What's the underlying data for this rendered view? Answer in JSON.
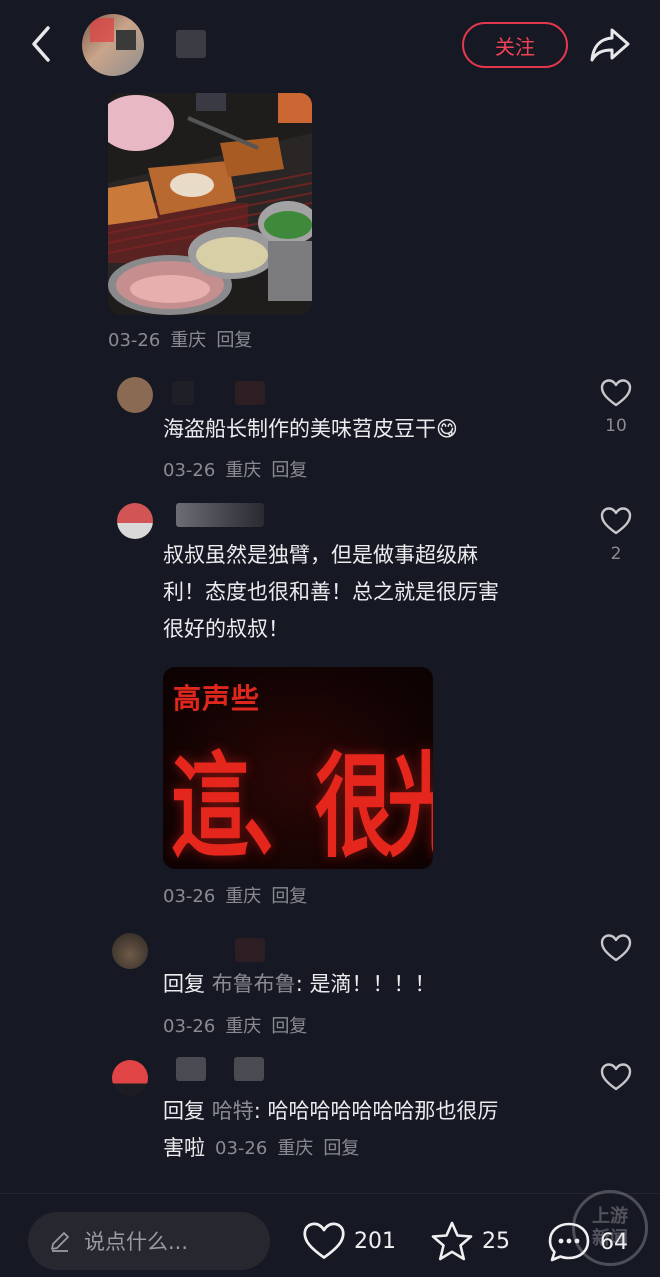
{
  "header": {
    "follow_label": "关注"
  },
  "post": {
    "meta": {
      "date": "03-26",
      "location": "重庆",
      "reply": "回复"
    }
  },
  "comments": [
    {
      "text": "海盗船长制作的美味苕皮豆干",
      "emoji": "😋",
      "meta": {
        "date": "03-26",
        "location": "重庆",
        "reply": "回复"
      },
      "likes": "10"
    },
    {
      "text_line1": "叔叔虽然是独臂，但是做事超级麻",
      "text_line2": "利！态度也很和善！总之就是很厉害",
      "text_line3": "很好的叔叔！",
      "sticker": {
        "small": "高声些",
        "big": "這、很光彩!"
      },
      "meta": {
        "date": "03-26",
        "location": "重庆",
        "reply": "回复"
      },
      "likes": "2"
    },
    {
      "reply_prefix": "回复",
      "mention": "布鲁布鲁",
      "text": ": 是滴！！！！",
      "meta": {
        "date": "03-26",
        "location": "重庆",
        "reply": "回复"
      }
    },
    {
      "reply_prefix": "回复",
      "mention": "哈特",
      "text": ": 哈哈哈哈哈哈哈那也很厉",
      "text_line2": "害啦",
      "meta": {
        "date": "03-26",
        "location": "重庆",
        "reply": "回复"
      }
    }
  ],
  "bottom_bar": {
    "input_placeholder": "说点什么...",
    "likes": "201",
    "favorites": "25",
    "comments": "64"
  },
  "watermark": {
    "line1": "上游",
    "line2": "新闻"
  },
  "colors": {
    "background": "#161823",
    "accent": "#e2384e",
    "muted": "#8a8b92"
  }
}
